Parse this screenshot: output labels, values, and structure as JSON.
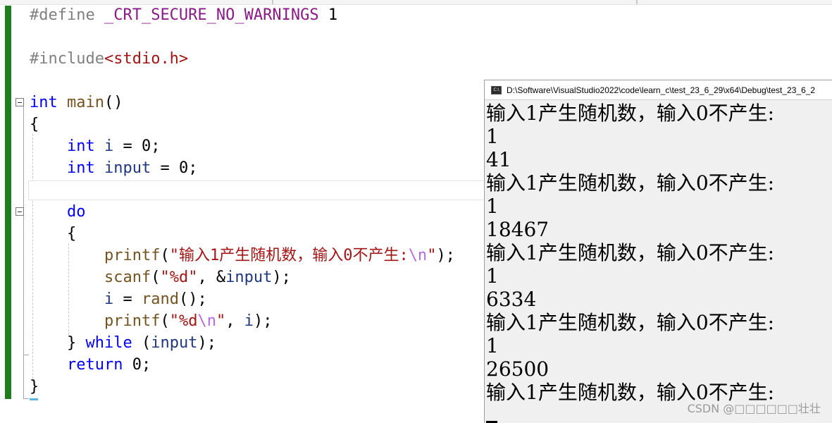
{
  "editor": {
    "lines": [
      {
        "parts": [
          {
            "t": "#define ",
            "c": "pre"
          },
          {
            "t": "_CRT_SECURE_NO_WARNINGS",
            "c": "macro"
          },
          {
            "t": " 1",
            "c": ""
          }
        ]
      },
      {
        "parts": []
      },
      {
        "parts": [
          {
            "t": "#include",
            "c": "pre"
          },
          {
            "t": "<stdio.h>",
            "c": "hdr"
          }
        ]
      },
      {
        "parts": []
      },
      {
        "parts": [
          {
            "t": "int",
            "c": "kw"
          },
          {
            "t": " ",
            "c": ""
          },
          {
            "t": "main",
            "c": "fn"
          },
          {
            "t": "()",
            "c": ""
          }
        ]
      },
      {
        "parts": [
          {
            "t": "{",
            "c": ""
          }
        ]
      },
      {
        "parts": [
          {
            "t": "    ",
            "c": ""
          },
          {
            "t": "int",
            "c": "kw"
          },
          {
            "t": " ",
            "c": ""
          },
          {
            "t": "i",
            "c": "var"
          },
          {
            "t": " = 0;",
            "c": ""
          }
        ]
      },
      {
        "parts": [
          {
            "t": "    ",
            "c": ""
          },
          {
            "t": "int",
            "c": "kw"
          },
          {
            "t": " ",
            "c": ""
          },
          {
            "t": "input",
            "c": "var"
          },
          {
            "t": " = 0;",
            "c": ""
          }
        ]
      },
      {
        "parts": []
      },
      {
        "parts": [
          {
            "t": "    ",
            "c": ""
          },
          {
            "t": "do",
            "c": "kw"
          }
        ]
      },
      {
        "parts": [
          {
            "t": "    {",
            "c": ""
          }
        ]
      },
      {
        "parts": [
          {
            "t": "        ",
            "c": ""
          },
          {
            "t": "printf",
            "c": "fn"
          },
          {
            "t": "(",
            "c": ""
          },
          {
            "t": "\"输入1产生随机数，输入0不产生:",
            "c": "str"
          },
          {
            "t": "\\n",
            "c": "esc"
          },
          {
            "t": "\"",
            "c": "str"
          },
          {
            "t": ");",
            "c": ""
          }
        ]
      },
      {
        "parts": [
          {
            "t": "        ",
            "c": ""
          },
          {
            "t": "scanf",
            "c": "fn"
          },
          {
            "t": "(",
            "c": ""
          },
          {
            "t": "\"%d\"",
            "c": "str"
          },
          {
            "t": ", &",
            "c": ""
          },
          {
            "t": "input",
            "c": "var"
          },
          {
            "t": ");",
            "c": ""
          }
        ]
      },
      {
        "parts": [
          {
            "t": "        ",
            "c": ""
          },
          {
            "t": "i",
            "c": "var"
          },
          {
            "t": " = ",
            "c": ""
          },
          {
            "t": "rand",
            "c": "fn"
          },
          {
            "t": "();",
            "c": ""
          }
        ]
      },
      {
        "parts": [
          {
            "t": "        ",
            "c": ""
          },
          {
            "t": "printf",
            "c": "fn"
          },
          {
            "t": "(",
            "c": ""
          },
          {
            "t": "\"%d",
            "c": "str"
          },
          {
            "t": "\\n",
            "c": "esc"
          },
          {
            "t": "\"",
            "c": "str"
          },
          {
            "t": ", ",
            "c": ""
          },
          {
            "t": "i",
            "c": "var"
          },
          {
            "t": ");",
            "c": ""
          }
        ]
      },
      {
        "parts": [
          {
            "t": "    } ",
            "c": ""
          },
          {
            "t": "while",
            "c": "kw"
          },
          {
            "t": " (",
            "c": ""
          },
          {
            "t": "input",
            "c": "var"
          },
          {
            "t": ");",
            "c": ""
          }
        ]
      },
      {
        "parts": [
          {
            "t": "    ",
            "c": ""
          },
          {
            "t": "return",
            "c": "kw"
          },
          {
            "t": " 0;",
            "c": ""
          }
        ]
      },
      {
        "parts": [
          {
            "t": "}",
            "c": ""
          }
        ]
      }
    ]
  },
  "console": {
    "title": "D:\\Software\\VisualStudio2022\\code\\learn_c\\test_23_6_29\\x64\\Debug\\test_23_6_2",
    "icon_label": "C:\\",
    "output": [
      "输入1产生随机数，输入0不产生:",
      "1",
      "41",
      "输入1产生随机数，输入0不产生:",
      "1",
      "18467",
      "输入1产生随机数，输入0不产生:",
      "1",
      "6334",
      "输入1产生随机数，输入0不产生:",
      "1",
      "26500",
      "输入1产生随机数，输入0不产生:"
    ]
  },
  "watermark": "CSDN @□□□□□□壮壮"
}
